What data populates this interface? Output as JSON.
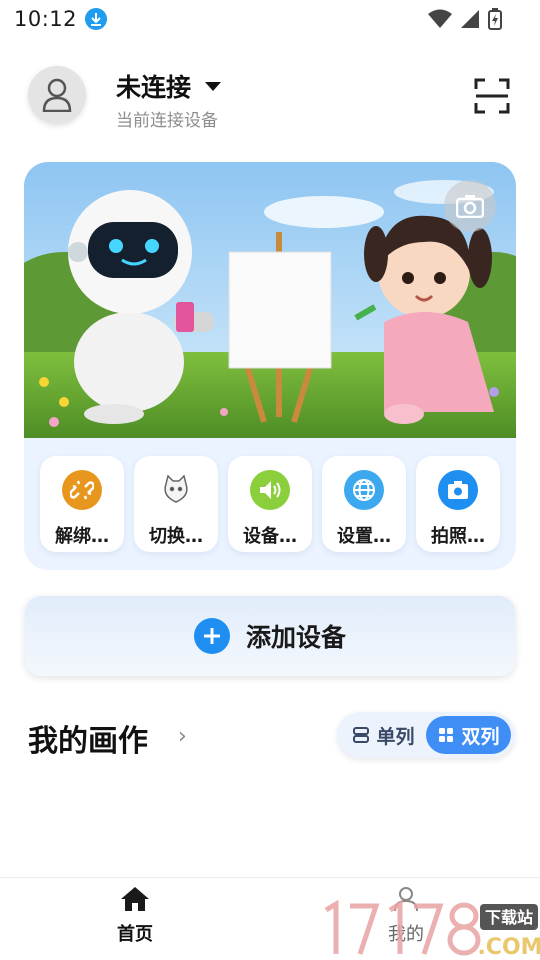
{
  "status_bar": {
    "time": "10:12"
  },
  "header": {
    "title": "未连接",
    "subtitle": "当前连接设备"
  },
  "actions": [
    {
      "label": "解绑…",
      "icon": "unlink-icon",
      "color": "#e8971e"
    },
    {
      "label": "切换…",
      "icon": "cat-icon",
      "color": "#ffffff"
    },
    {
      "label": "设备…",
      "icon": "volume-icon",
      "color": "#8bcf3c"
    },
    {
      "label": "设置…",
      "icon": "globe-icon",
      "color": "#3ba8ef"
    },
    {
      "label": "拍照…",
      "icon": "camera-icon",
      "color": "#1e8ef0"
    }
  ],
  "add_device": {
    "label": "添加设备"
  },
  "gallery": {
    "title": "我的画作",
    "view_single": "单列",
    "view_double": "双列",
    "selected_view": "双列"
  },
  "bottom_nav": {
    "home": "首页",
    "me": "我的"
  },
  "watermark": {
    "text": "下载站"
  },
  "colors": {
    "accent": "#1e8ef0",
    "toggle_active": "#3f8ef5"
  }
}
